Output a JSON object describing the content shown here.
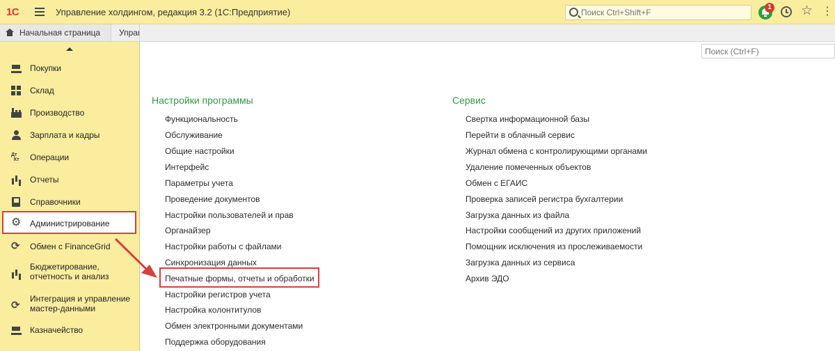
{
  "titlebar": {
    "logo": "1С",
    "title": "Управление холдингом, редакция 3.2  (1С:Предприятие)",
    "search_placeholder": "Поиск Ctrl+Shift+F",
    "notification_count": "1",
    "more": "⋮"
  },
  "tabs": {
    "home": "Начальная страница",
    "partial": "Управ"
  },
  "sidebar": {
    "items": [
      {
        "label": "Покупки",
        "icon": "cart-icon"
      },
      {
        "label": "Склад",
        "icon": "warehouse-icon"
      },
      {
        "label": "Производство",
        "icon": "factory-icon"
      },
      {
        "label": "Зарплата и кадры",
        "icon": "person-icon"
      },
      {
        "label": "Операции",
        "icon": "dt-kt-icon"
      },
      {
        "label": "Отчеты",
        "icon": "bar-chart-icon"
      },
      {
        "label": "Справочники",
        "icon": "book-icon"
      },
      {
        "label": "Администрирование",
        "icon": "gear-icon",
        "selected": true
      },
      {
        "label": "Обмен с FinanceGrid",
        "icon": "sync-icon"
      },
      {
        "label_line1": "Бюджетирование,",
        "label_line2": "отчетность и анализ",
        "icon": "chart-icon"
      },
      {
        "label_line1": "Интеграция и управление",
        "label_line2": "мастер-данными",
        "icon": "sync-icon"
      },
      {
        "label": "Казначейство",
        "icon": "cash-icon"
      }
    ]
  },
  "main": {
    "search_placeholder": "Поиск (Ctrl+F)",
    "settings": {
      "title": "Настройки программы",
      "links": [
        "Функциональность",
        "Обслуживание",
        "Общие настройки",
        "Интерфейс",
        "Параметры учета",
        "Проведение документов",
        "Настройки пользователей и прав",
        "Органайзер",
        "Настройки работы с файлами",
        "Синхронизация данных",
        "Печатные формы, отчеты и обработки",
        "Настройки регистров учета",
        "Настройка колонтитулов",
        "Обмен электронными документами",
        "Поддержка оборудования"
      ]
    },
    "service": {
      "title": "Сервис",
      "links": [
        "Свертка информационной базы",
        "Перейти в облачный сервис",
        "Журнал обмена с контролирующими органами",
        "Удаление помеченных объектов",
        "Обмен с ЕГАИС",
        "Проверка записей регистра бухгалтерии",
        "Загрузка данных из файла",
        "Настройки сообщений из других приложений",
        "Помощник исключения из прослеживаемости",
        "Загрузка данных из сервиса",
        "Архив ЭДО"
      ]
    }
  },
  "colors": {
    "titlebar_bg": "#fbed9e",
    "section_title": "#2f9a49",
    "annotation": "#d4413b",
    "notification": "#2e9e3e"
  }
}
